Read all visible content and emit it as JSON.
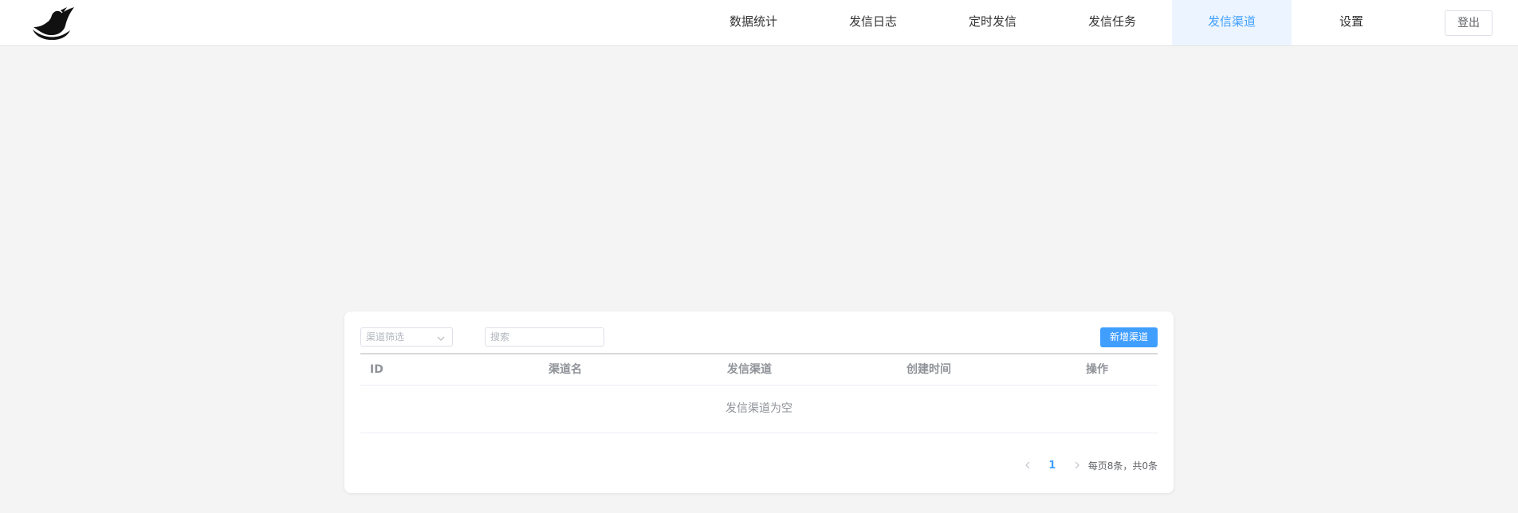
{
  "header": {
    "nav": [
      {
        "label": "数据统计"
      },
      {
        "label": "发信日志"
      },
      {
        "label": "定时发信"
      },
      {
        "label": "发信任务"
      },
      {
        "label": "发信渠道",
        "active": true
      },
      {
        "label": "设置"
      }
    ],
    "logout_label": "登出"
  },
  "toolbar": {
    "filter_placeholder": "渠道筛选",
    "search_placeholder": "搜索",
    "add_label": "新增渠道"
  },
  "table": {
    "columns": [
      "ID",
      "渠道名",
      "发信渠道",
      "创建时间",
      "操作"
    ],
    "empty_text": "发信渠道为空"
  },
  "pagination": {
    "current_page": "1",
    "summary": "每页8条，共0条"
  },
  "colors": {
    "accent": "#409eff",
    "active_nav_bg": "#ecf5ff",
    "page_bg": "#f4f4f4"
  },
  "icons": {
    "logo": "dove-logo-icon",
    "select": "chevron-down-icon",
    "prev": "chevron-left-icon",
    "next": "chevron-right-icon"
  }
}
